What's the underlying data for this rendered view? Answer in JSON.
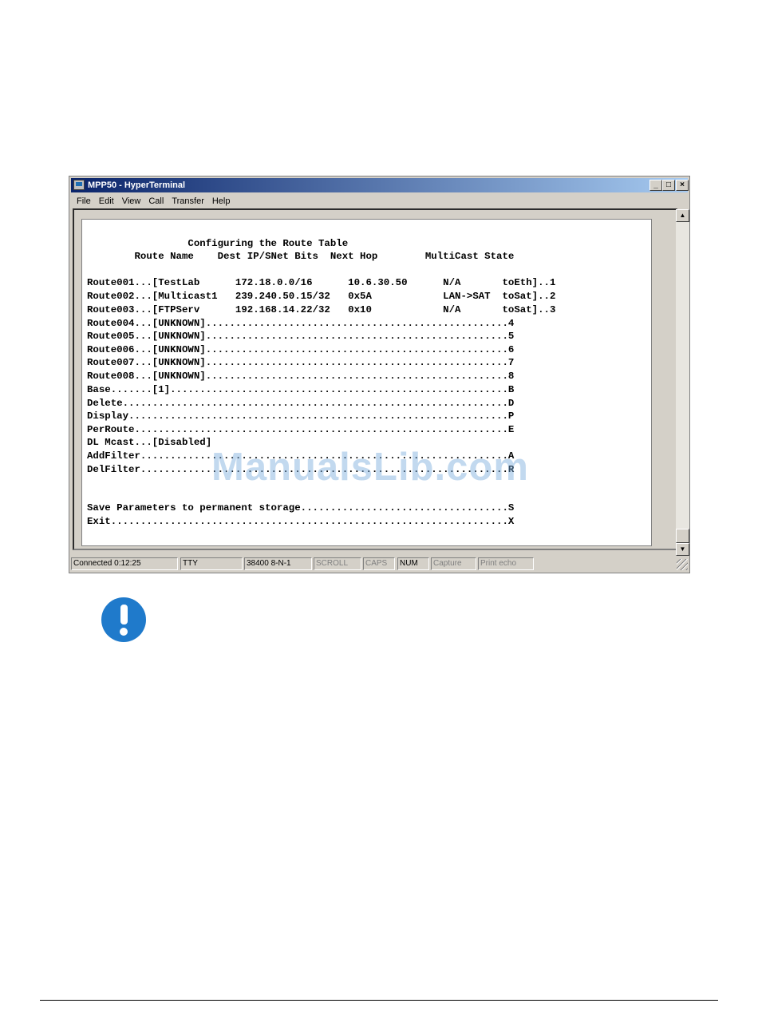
{
  "window": {
    "title": "MPP50 - HyperTerminal",
    "controls": {
      "minimize": "_",
      "maximize": "□",
      "close": "×"
    }
  },
  "menu": [
    "File",
    "Edit",
    "View",
    "Call",
    "Transfer",
    "Help"
  ],
  "terminal": {
    "lines": [
      "                 Configuring the Route Table",
      "        Route Name    Dest IP/SNet Bits  Next Hop        MultiCast State",
      "Route001...[TestLab      172.18.0.0/16      10.6.30.50      N/A       toEth]..1",
      "Route002...[Multicast1   239.240.50.15/32   0x5A            LAN->SAT  toSat]..2",
      "Route003...[FTPServ      192.168.14.22/32   0x10            N/A       toSat]..3",
      "Route004...[UNKNOWN]...................................................4",
      "Route005...[UNKNOWN]...................................................5",
      "Route006...[UNKNOWN]...................................................6",
      "Route007...[UNKNOWN]...................................................7",
      "Route008...[UNKNOWN]...................................................8",
      "Base.......[1].........................................................B",
      "Delete.................................................................D",
      "Display................................................................P",
      "PerRoute...............................................................E",
      "DL Mcast...[Disabled]",
      "AddFilter..............................................................A",
      "DelFilter..............................................................R",
      "Save Parameters to permanent storage...................................S",
      "Exit...................................................................X"
    ]
  },
  "statusbar": {
    "connected": "Connected 0:12:25",
    "emulation": "TTY",
    "settings": "38400 8-N-1",
    "scroll": "SCROLL",
    "caps": "CAPS",
    "num": "NUM",
    "capture": "Capture",
    "print_echo": "Print echo"
  },
  "watermark": "ManualsLib.com",
  "icons": {
    "notice": "exclamation-circle-icon",
    "notice_color": "#1f7acb"
  }
}
